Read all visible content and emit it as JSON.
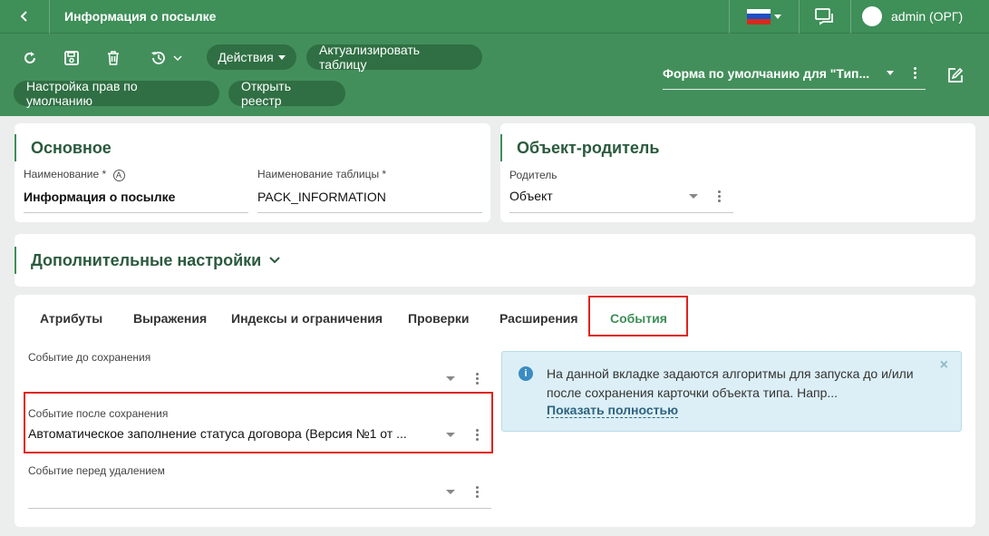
{
  "header": {
    "title": "Информация о посылке",
    "user": "admin (ОРГ)"
  },
  "toolbar": {
    "actions_label": "Действия",
    "refresh_table_label": "Актуализировать таблицу",
    "default_rights_label": "Настройка прав по умолчанию",
    "open_registry_label": "Открыть реестр",
    "form_select_value": "Форма по умолчанию для \"Тип..."
  },
  "main_card": {
    "heading": "Основное",
    "name_label": "Наименование *",
    "name_value": "Информация о посылке",
    "table_label": "Наименование таблицы *",
    "table_value": "PACK_INFORMATION"
  },
  "parent_card": {
    "heading": "Объект-родитель",
    "parent_label": "Родитель",
    "parent_value": "Объект"
  },
  "extra": {
    "heading": "Дополнительные настройки"
  },
  "tabs": [
    {
      "label": "Атрибуты"
    },
    {
      "label": "Выражения"
    },
    {
      "label": "Индексы и ограничения"
    },
    {
      "label": "Проверки"
    },
    {
      "label": "Расширения"
    },
    {
      "label": "События"
    }
  ],
  "events": {
    "before_save_label": "Событие до сохранения",
    "before_save_value": "",
    "after_save_label": "Событие после сохранения",
    "after_save_value": "Автоматическое заполнение статуса договора (Версия №1 от ...",
    "before_delete_label": "Событие перед удалением",
    "before_delete_value": ""
  },
  "info": {
    "message": "На данной вкладке задаются алгоритмы для запуска до и/или после сохранения карточки объекта типа. Напр...",
    "show_more": "Показать полностью"
  },
  "colors": {
    "primary_green": "#3e8f58",
    "dark_pill": "#2f6f43",
    "highlight_red": "#e0231c",
    "info_bg": "#dceff6"
  },
  "icons": [
    "back-icon",
    "flag-ru-icon",
    "chat-icon",
    "refresh-icon",
    "save-icon",
    "delete-icon",
    "history-icon",
    "edit-icon",
    "info-icon",
    "close-icon"
  ]
}
